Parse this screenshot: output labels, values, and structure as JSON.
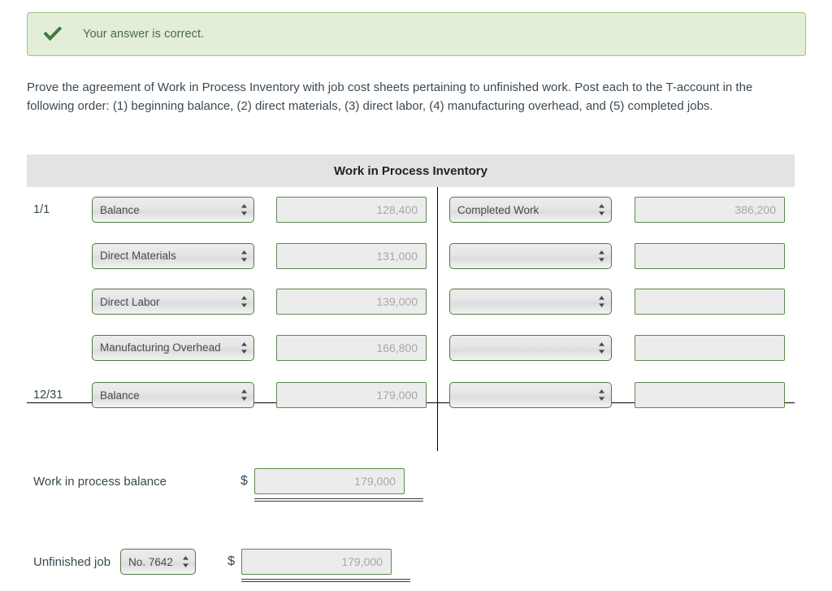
{
  "alert": {
    "icon": "check-icon",
    "message": "Your answer is correct.",
    "bg_color": "#e2eed8",
    "border_color": "#9ec28a",
    "text_color": "#4a6b43"
  },
  "instructions": {
    "text": "Prove the agreement of Work in Process Inventory with job cost sheets pertaining to unfinished work. Post each to the T-account in the following order: (1) beginning balance, (2) direct materials, (3) direct labor, (4) manufacturing overhead, and (5) completed jobs."
  },
  "taccount": {
    "title": "Work in Process Inventory",
    "header_bg": "#e3e3e3",
    "select_border_color": "#4f7a42",
    "input_border_color": "#5b8a4d",
    "rows": [
      {
        "date": "1/1",
        "debit_account": "Balance",
        "debit_amount": "128,400",
        "credit_account": "Completed Work",
        "credit_amount": "386,200"
      },
      {
        "date": "",
        "debit_account": "Direct Materials",
        "debit_amount": "131,000",
        "credit_account": "",
        "credit_amount": ""
      },
      {
        "date": "",
        "debit_account": "Direct Labor",
        "debit_amount": "139,000",
        "credit_account": "",
        "credit_amount": ""
      },
      {
        "date": "",
        "debit_account": "Manufacturing Overhead",
        "debit_amount": "166,800",
        "credit_account": "",
        "credit_amount": ""
      }
    ],
    "balance_row": {
      "date": "12/31",
      "debit_account": "Balance",
      "debit_amount": "179,000",
      "credit_account": "",
      "credit_amount": ""
    },
    "account_options": [
      "Balance",
      "Direct Materials",
      "Direct Labor",
      "Manufacturing Overhead",
      "Completed Work"
    ]
  },
  "summary": {
    "wip_balance": {
      "label": "Work in process balance",
      "currency": "$",
      "amount": "179,000"
    },
    "unfinished_job": {
      "label": "Unfinished job",
      "job_number": "No. 7642",
      "currency": "$",
      "amount": "179,000",
      "job_options": [
        "No. 7642"
      ]
    }
  }
}
